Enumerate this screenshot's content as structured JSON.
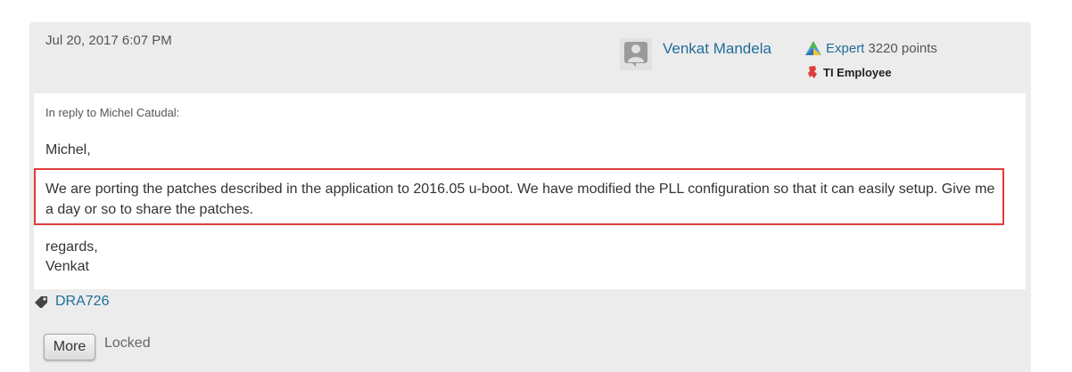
{
  "post": {
    "timestamp": "Jul 20, 2017 6:07 PM",
    "author": "Venkat Mandela",
    "rank": "Expert",
    "points": "3220 points",
    "badge": "TI Employee",
    "reply_to": "In reply to Michel Catudal:",
    "greeting": "Michel,",
    "body": "We are porting the patches described in the application to 2016.05 u-boot. We have modified the PLL configuration so that it can easily setup. Give me a day or so to share the patches.",
    "signoff": "regards,\nVenkat",
    "tag": "DRA726",
    "more_label": "More",
    "status": "Locked",
    "highlight_color": "#e03c3c",
    "link_color": "#1f6e98"
  }
}
